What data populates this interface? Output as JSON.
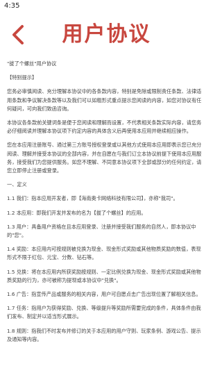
{
  "status_bar": {
    "time": "4:35"
  },
  "header": {
    "back_icon": "chevron-left-icon",
    "title": "用户协议",
    "accent_color": "#c8473f"
  },
  "content": {
    "paragraphs": [
      "\"拔了个螺丝\"用户协议",
      "【特别提示】",
      "您务必审慎阅读、充分理解本协议中的各条款内容，特别是免除或限制责任条款、法律适用条款和争议解决条款等以及我们可以如粗形式重点提示您阅读的内容，如您对协议有任何疑问，可向我们致函咨询。",
      "本协议各条款前关键词条是便于您阅读和理解而设置，不代表相关条款实际内容，请您务必仔细阅读并理解本协议项下约定内容的具体含义后再使用本应用并继续相应操作。",
      "您在本应用注册账号、通过第三方账号授权登录或以其他方式使用本应用即表示您已充分阅读、理解并接受本协议的全部内容，并在自愿在与我们订立本协议前提下使用本应用服务，接受我们为您提供服务。如您不理解、不同意本协议项下全部或部分的任何约定，请您立即停止注册或登录。",
      "一、定义",
      "1.1 我们：指本应用开发者，即【海南奥卡网络科技有限公司】，亦称\"我司\"。",
      "1.2 本应用：即我们开发并发布的名为【拔了个螺丝】的应用。",
      "1.3 用户：具备用户资格在且本应用登录、注册并接受我们服务的自然人，即本协议中的\"您\"。",
      "1.4 奖励：本应用内可按规则被兑换为现金、现金形式奖励或其他物质奖励的数值，表现形式不限于红包、元宝、分数、钻石等。",
      "1.5 兑换：将在本应用内所获奖励按规则、一定比例兑换为现金、现金形式奖励或其他物质奖励的行为，亦可被称为提现或本协议中\"兑换\"。",
      "1.6 广告：指宣传产品或服务的相关内容，用户可自愿点击广告出现位置了解相关信息。",
      "1.7 任务：指用户为获得奖励、兑换、等级提升等奖励所需要完成的条件，具体条件由我们发布、制定并以适当形式展示。",
      "1.8 规则：指我们不时发布并修订的关于本应用的用户守则、玩家条例、游戏公告、提示及通知等内容。"
    ]
  }
}
